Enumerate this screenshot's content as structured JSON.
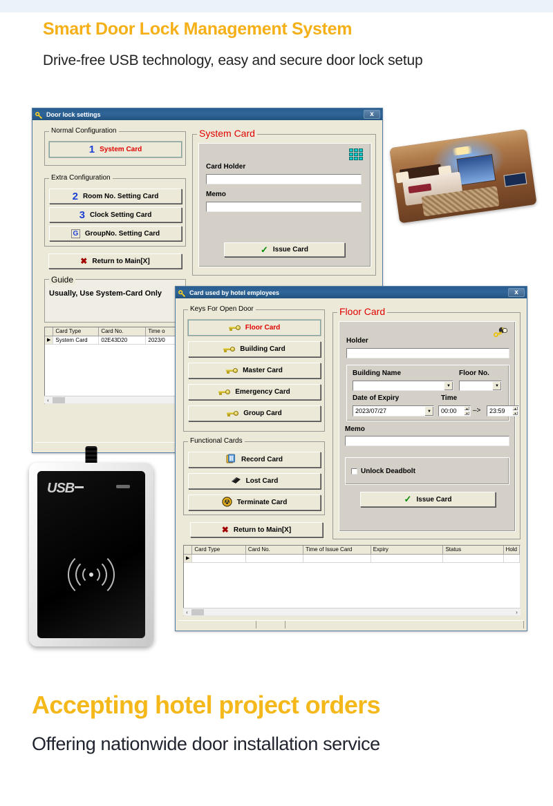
{
  "header": {
    "title": "Smart Door Lock Management System",
    "subtitle": "Drive-free USB technology, easy and secure door lock setup",
    "title_color": "#f5b017"
  },
  "footer": {
    "title": "Accepting hotel project orders",
    "subtitle": "Offering nationwide door installation service",
    "title_color": "#f5b81a"
  },
  "dialog1": {
    "title": "Door lock settings",
    "close_label": "x",
    "normal_group": "Normal Configuration",
    "extra_group": "Extra Configuration",
    "guide_group": "Guide",
    "guide_text": "Usually, Use System-Card Only",
    "buttons": {
      "system_card": {
        "num": "1",
        "label": "System Card"
      },
      "room_no": {
        "num": "2",
        "label": "Room No. Setting Card"
      },
      "clock": {
        "num": "3",
        "label": "Clock Setting Card"
      },
      "group_no": {
        "num": "G",
        "label": "GroupNo. Setting Card"
      },
      "return_main": {
        "label": "Return to Main[X]"
      }
    },
    "right_panel": {
      "caption": "System Card",
      "card_holder_label": "Card Holder",
      "card_holder_value": "",
      "memo_label": "Memo",
      "memo_value": "",
      "issue_label": "Issue Card"
    },
    "table": {
      "columns": [
        "",
        "Card Type",
        "Card No.",
        "Time o"
      ],
      "rows": [
        {
          "mark": "▶",
          "card_type": "System Card",
          "card_no": "02E43D20",
          "time": "2023/0"
        }
      ]
    }
  },
  "dialog2": {
    "title": "Card used by hotel employees",
    "close_label": "x",
    "keys_group": "Keys For Open Door",
    "functional_group": "Functional Cards",
    "key_buttons": [
      {
        "label": "Floor Card",
        "selected": true
      },
      {
        "label": "Building Card",
        "selected": false
      },
      {
        "label": "Master Card",
        "selected": false
      },
      {
        "label": "Emergency Card",
        "selected": false
      },
      {
        "label": "Group Card",
        "selected": false
      }
    ],
    "functional_buttons": [
      {
        "label": "Record Card",
        "icon": "record-card-icon"
      },
      {
        "label": "Lost Card",
        "icon": "lost-card-icon"
      },
      {
        "label": "Terminate Card",
        "icon": "terminate-card-icon"
      }
    ],
    "return_main": "Return to Main[X]",
    "right_panel": {
      "caption": "Floor Card",
      "holder_label": "Holder",
      "holder_value": "",
      "building_label": "Building Name",
      "building_value": "",
      "floor_label": "Floor No.",
      "floor_value": "",
      "expiry_label": "Date of Expiry",
      "expiry_value": "2023/07/27",
      "time_label": "Time",
      "time_from": "00:00",
      "time_to": "23:59",
      "time_sep": "–>",
      "memo_label": "Memo",
      "memo_value": "",
      "unlock_label": "Unlock Deadbolt",
      "unlock_checked": false,
      "issue_label": "Issue Card"
    },
    "table": {
      "columns": [
        "",
        "Card Type",
        "Card No.",
        "Time of Issue Card",
        "Expiry",
        "Status",
        "Hold"
      ],
      "rows": [
        {
          "mark": "▶",
          "card_type": "",
          "card_no": "",
          "issue_time": "",
          "expiry": "",
          "status": "",
          "holder": ""
        }
      ]
    }
  },
  "photos": {
    "key_card": "hotel-room-key-card",
    "usb_reader_label": "USB"
  }
}
